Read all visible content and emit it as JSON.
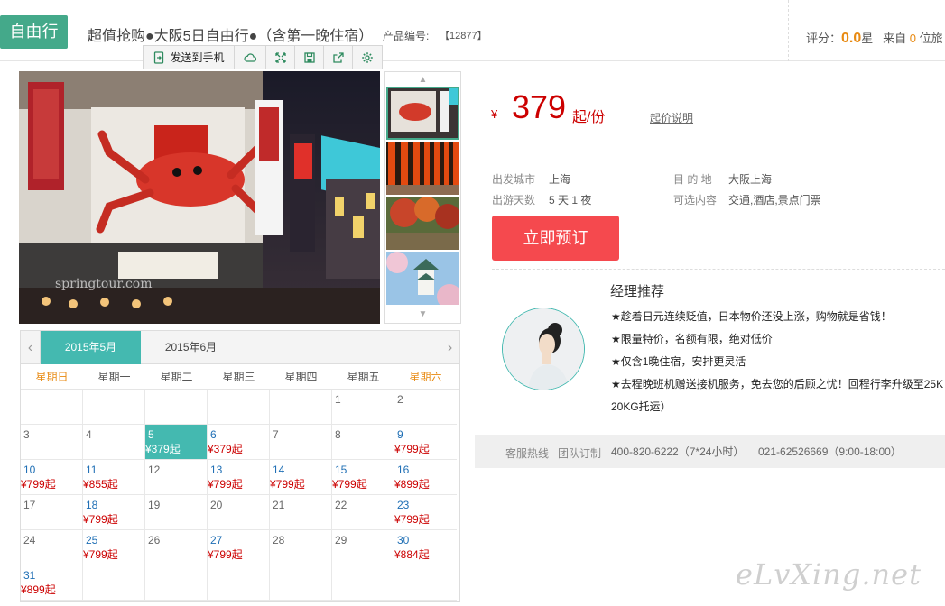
{
  "header": {
    "tag": "自由行",
    "title": "超值抢购●大阪5日自由行●（含第一晚住宿）",
    "product_no_label": "产品编号:",
    "product_no": "【12877】",
    "rating_label": "评分：",
    "rating_value": "0.0",
    "rating_unit": "星",
    "from_label": "来自",
    "from_count": "0",
    "from_unit": "位旅"
  },
  "toolbar": {
    "send_label": "发送到手机",
    "icons": [
      "cloud-icon",
      "fullscreen-icon",
      "save-icon",
      "share-icon",
      "settings-icon"
    ]
  },
  "price": {
    "currency": "¥",
    "value": "379",
    "unit": "起/份",
    "note": "起价说明"
  },
  "info": {
    "depart_label": "出发城市",
    "depart_value": "上海",
    "days_label": "出游天数",
    "days_value": "5 天 1 夜",
    "dest_label": "目 的 地",
    "dest_value": "大阪上海",
    "options_label": "可选内容",
    "options_value": "交通,酒店,景点门票"
  },
  "book_button": "立即预订",
  "manager": {
    "title": "经理推荐",
    "points": [
      "★趁着日元连续贬值，日本物价还没上涨，购物就是省钱！",
      "★限量特价，名额有限，绝对低价",
      "★仅含1晚住宿，安排更灵活",
      "★去程晚班机赠送接机服务，免去您的后顾之忧！回程行李升级至25K",
      "20KG托运）"
    ]
  },
  "hotline": {
    "label1": "客服热线",
    "label2": "团队订制",
    "phone1": "400-820-6222（7*24小时）",
    "phone2": "021-62526669（9:00-18:00）"
  },
  "calendar": {
    "tabs": [
      "2015年5月",
      "2015年6月"
    ],
    "active_tab": 0,
    "weekdays": [
      "星期日",
      "星期一",
      "星期二",
      "星期三",
      "星期四",
      "星期五",
      "星期六"
    ],
    "cells": [
      {
        "d": "",
        "p": ""
      },
      {
        "d": "",
        "p": ""
      },
      {
        "d": "",
        "p": ""
      },
      {
        "d": "",
        "p": ""
      },
      {
        "d": "",
        "p": ""
      },
      {
        "d": "1",
        "p": ""
      },
      {
        "d": "2",
        "p": ""
      },
      {
        "d": "3",
        "p": ""
      },
      {
        "d": "4",
        "p": ""
      },
      {
        "d": "5",
        "p": "¥379起",
        "sel": true
      },
      {
        "d": "6",
        "p": "¥379起"
      },
      {
        "d": "7",
        "p": ""
      },
      {
        "d": "8",
        "p": ""
      },
      {
        "d": "9",
        "p": "¥799起"
      },
      {
        "d": "10",
        "p": "¥799起"
      },
      {
        "d": "11",
        "p": "¥855起"
      },
      {
        "d": "12",
        "p": ""
      },
      {
        "d": "13",
        "p": "¥799起"
      },
      {
        "d": "14",
        "p": "¥799起"
      },
      {
        "d": "15",
        "p": "¥799起"
      },
      {
        "d": "16",
        "p": "¥899起"
      },
      {
        "d": "17",
        "p": ""
      },
      {
        "d": "18",
        "p": "¥799起"
      },
      {
        "d": "19",
        "p": ""
      },
      {
        "d": "20",
        "p": ""
      },
      {
        "d": "21",
        "p": ""
      },
      {
        "d": "22",
        "p": ""
      },
      {
        "d": "23",
        "p": "¥799起"
      },
      {
        "d": "24",
        "p": ""
      },
      {
        "d": "25",
        "p": "¥799起"
      },
      {
        "d": "26",
        "p": ""
      },
      {
        "d": "27",
        "p": "¥799起"
      },
      {
        "d": "28",
        "p": ""
      },
      {
        "d": "29",
        "p": ""
      },
      {
        "d": "30",
        "p": "¥884起"
      },
      {
        "d": "31",
        "p": "¥899起"
      },
      {
        "d": "",
        "p": ""
      },
      {
        "d": "",
        "p": ""
      },
      {
        "d": "",
        "p": ""
      },
      {
        "d": "",
        "p": ""
      },
      {
        "d": "",
        "p": ""
      },
      {
        "d": "",
        "p": ""
      }
    ]
  },
  "watermark": "eLvXing.net",
  "colors": {
    "accent": "#44b9b0",
    "brand_green": "#44a98a",
    "price_red": "#cc0000",
    "book_button": "#f5494e",
    "weekend": "#e88a12"
  }
}
